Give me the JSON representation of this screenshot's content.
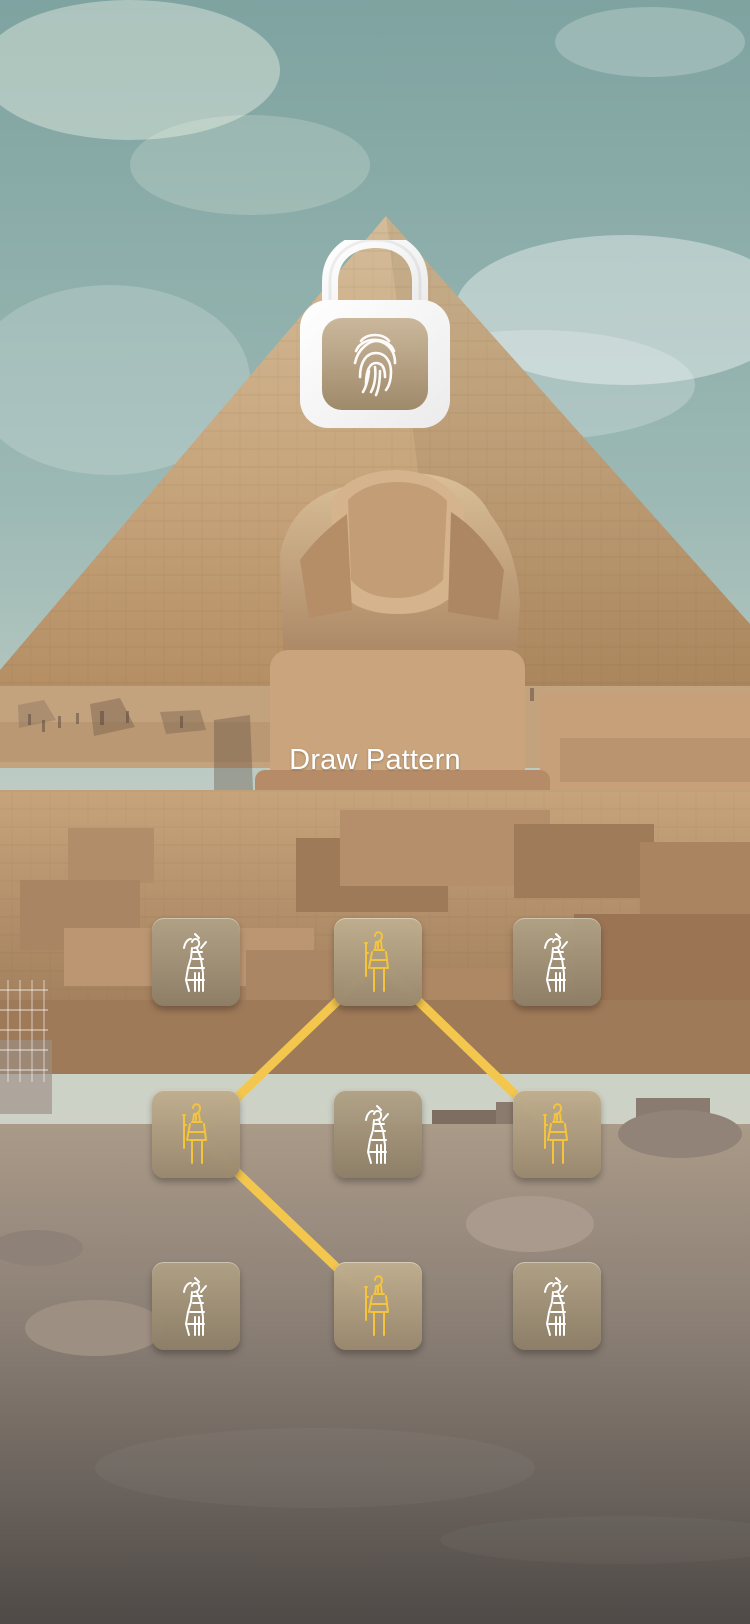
{
  "screen": {
    "title": "Draw Pattern"
  },
  "theme": {
    "line_color": "#F3C64D",
    "tile_active_glyph": "#F4C43C",
    "tile_inactive_glyph": "#FFFFFF"
  },
  "lock": {
    "icon": "fingerprint-padlock-icon"
  },
  "pattern": {
    "grid_rows": 3,
    "grid_columns": 3,
    "selected_sequence": [
      2,
      6,
      4,
      8
    ],
    "tiles": [
      {
        "id": 1,
        "icon": "egyptian-pharaoh-icon",
        "active": false
      },
      {
        "id": 2,
        "icon": "egyptian-pharaoh-icon",
        "active": true
      },
      {
        "id": 3,
        "icon": "egyptian-pharaoh-icon",
        "active": false
      },
      {
        "id": 4,
        "icon": "egyptian-pharaoh-icon",
        "active": true
      },
      {
        "id": 5,
        "icon": "egyptian-pharaoh-icon",
        "active": false
      },
      {
        "id": 6,
        "icon": "egyptian-pharaoh-icon",
        "active": true
      },
      {
        "id": 7,
        "icon": "egyptian-pharaoh-icon",
        "active": false
      },
      {
        "id": 8,
        "icon": "egyptian-pharaoh-icon",
        "active": true
      },
      {
        "id": 9,
        "icon": "egyptian-pharaoh-icon",
        "active": false
      }
    ]
  }
}
